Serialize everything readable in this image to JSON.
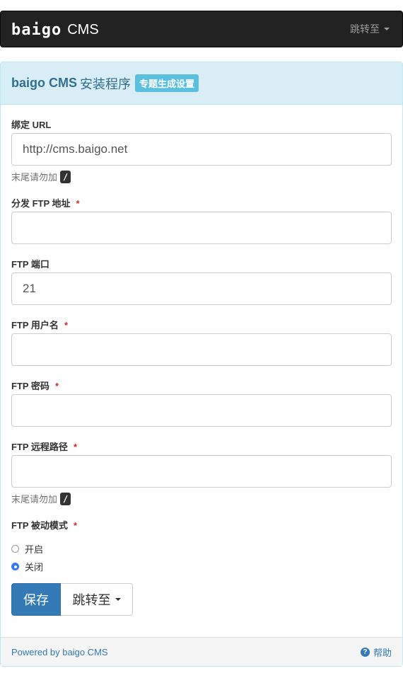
{
  "navbar": {
    "brand_logo_text": "baigo",
    "brand_suffix": "CMS",
    "jump_label": "跳转至",
    "jump_icon": "caret-down-icon"
  },
  "panel": {
    "title_main": "baigo CMS",
    "title_rest": "安装程序",
    "badge": "专题生成设置"
  },
  "form": {
    "bind_url": {
      "label": "绑定 URL",
      "value": "http://cms.baigo.net",
      "help": "末尾请勿加",
      "help_key": "/"
    },
    "ftp_host": {
      "label": "分发 FTP 地址",
      "required": "*",
      "value": ""
    },
    "ftp_port": {
      "label": "FTP 端口",
      "value": "21"
    },
    "ftp_user": {
      "label": "FTP 用户名",
      "required": "*",
      "value": ""
    },
    "ftp_pass": {
      "label": "FTP 密码",
      "required": "*",
      "value": ""
    },
    "ftp_path": {
      "label": "FTP 远程路径",
      "required": "*",
      "value": "",
      "help": "末尾请勿加",
      "help_key": "/"
    },
    "ftp_pasv": {
      "label": "FTP 被动模式",
      "required": "*",
      "options": [
        {
          "label": "开启",
          "selected": false
        },
        {
          "label": "关闭",
          "selected": true
        }
      ]
    }
  },
  "buttons": {
    "save": "保存",
    "jump": "跳转至"
  },
  "footer": {
    "powered": "Powered by baigo CMS",
    "help": "帮助",
    "help_icon": "question-circle-icon"
  },
  "colors": {
    "navbar_bg": "#222222",
    "panel_head_bg": "#d9edf7",
    "badge_bg": "#5bc0de",
    "primary": "#337ab7",
    "required": "#c9302c"
  }
}
